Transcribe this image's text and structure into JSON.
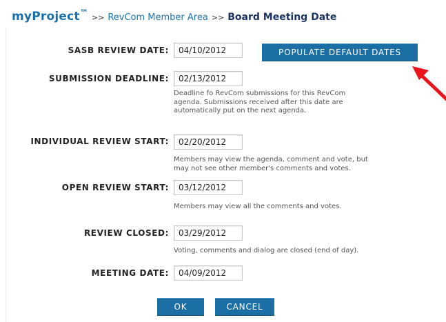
{
  "header": {
    "logo": "myProject",
    "trademark": "™",
    "separator": ">>",
    "crumb_link": "RevCom Member Area",
    "current_page": "Board Meeting Date"
  },
  "buttons": {
    "populate": "POPULATE DEFAULT DATES",
    "ok": "OK",
    "cancel": "CANCEL"
  },
  "fields": {
    "sasb_review_date": {
      "label": "SASB REVIEW DATE:",
      "value": "04/10/2012"
    },
    "submission_deadline": {
      "label": "SUBMISSION DEADLINE:",
      "value": "02/13/2012",
      "help": [
        "Deadline fo RevCom submissions for this RevCom",
        "agenda. Submissions received after this date are",
        "automatically put on the next agenda."
      ]
    },
    "individual_review_start": {
      "label": "INDIVIDUAL REVIEW START:",
      "value": "02/20/2012",
      "help": [
        "Members may view the agenda, comment and vote, but",
        "may not see other member's comments and votes."
      ]
    },
    "open_review_start": {
      "label": "OPEN REVIEW START:",
      "value": "03/12/2012",
      "help": [
        "Members may view all the comments and votes."
      ]
    },
    "review_closed": {
      "label": "REVIEW CLOSED:",
      "value": "03/29/2012",
      "help": [
        "Voting, comments and dialog are closed (end of day)."
      ]
    },
    "meeting_date": {
      "label": "MEETING DATE:",
      "value": "04/09/2012"
    }
  },
  "colors": {
    "button": "#1c6fa5",
    "logo": "#1a6fa8",
    "title": "#1b3466",
    "arrow": "#e8141c"
  },
  "icons": {
    "annotation_arrow": "red-arrow-icon"
  }
}
